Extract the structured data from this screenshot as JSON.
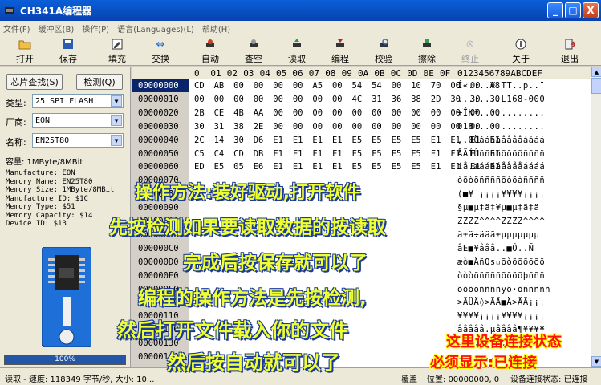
{
  "window": {
    "title": "CH341A编程器"
  },
  "window_controls": {
    "minimize": "_",
    "maximize": "□",
    "close": "X"
  },
  "menu": [
    "文件(F)",
    "缓冲区(B)",
    "操作(P)",
    "语言(Languages)(L)",
    "帮助(H)"
  ],
  "toolbar": [
    {
      "label": "打开",
      "icon": "open-icon",
      "glyph": "📂",
      "disabled": false
    },
    {
      "label": "保存",
      "icon": "save-icon",
      "glyph": "💾",
      "disabled": false
    },
    {
      "label": "填充",
      "icon": "fill-icon",
      "glyph": "✎",
      "disabled": false
    },
    {
      "label": "交换",
      "icon": "swap-icon",
      "glyph": "⇔",
      "disabled": false
    },
    {
      "label": "自动",
      "icon": "auto-icon",
      "glyph": "◆",
      "disabled": false
    },
    {
      "label": "查空",
      "icon": "blank-check-icon",
      "glyph": "◆",
      "disabled": false
    },
    {
      "label": "读取",
      "icon": "read-icon",
      "glyph": "◆",
      "disabled": false
    },
    {
      "label": "编程",
      "icon": "program-icon",
      "glyph": "◆",
      "disabled": false
    },
    {
      "label": "校验",
      "icon": "verify-icon",
      "glyph": "◆",
      "disabled": false
    },
    {
      "label": "擦除",
      "icon": "erase-icon",
      "glyph": "◆",
      "disabled": false
    },
    {
      "label": "终止",
      "icon": "stop-icon",
      "glyph": "⊗",
      "disabled": true
    },
    {
      "label": "关于",
      "icon": "about-icon",
      "glyph": "ⓘ",
      "disabled": false
    },
    {
      "label": "退出",
      "icon": "exit-icon",
      "glyph": "⇥",
      "disabled": false
    }
  ],
  "left": {
    "find_chip": "芯片查找(S)",
    "detect": "检测(Q)",
    "type_label": "类型:",
    "type_value": "25 SPI FLASH",
    "vendor_label": "厂商:",
    "vendor_value": "EON",
    "name_label": "名称:",
    "name_value": "EN25T80",
    "capacity": "容量: 1MByte/8MBit",
    "info": [
      "Manufacture: EON",
      "Memory Name: EN25T80",
      "Memory Size: 1MByte/8MBit",
      "Manufacture ID: $1C",
      "Memory Type: $51",
      "Memory Capacity: $14",
      "Device ID: $13"
    ],
    "progress_text": "100%",
    "progress_value": 1.0
  },
  "hex": {
    "header_cols": [
      "0",
      "01",
      "02",
      "03",
      "04",
      "05",
      "06",
      "07",
      "08",
      "09",
      "0A",
      "0B",
      "0C",
      "0D",
      "0E",
      "0F"
    ],
    "ascii_header": "0123456789ABCDEF",
    "rows": [
      {
        "addr": "00000000",
        "bytes": "CD AB 00 00 00 00 A5 00 54 54 00 10 70 00 00 A8",
        "ascii": "Í«....¥.TT..p..¨"
      },
      {
        "addr": "00000010",
        "bytes": "00 00 00 00 00 00 00 00 4C 31 36 38 2D 30 30 30",
        "ascii": "........L168-000"
      },
      {
        "addr": "00000020",
        "bytes": "2B CE 4B AA 00 00 00 00 00 00 00 00 00 00 00 00",
        "ascii": "+ÎKª............"
      },
      {
        "addr": "00000030",
        "bytes": "30 31 38 2E 00 00 00 00 00 00 00 00 00 00 00 00",
        "ascii": "018............."
      },
      {
        "addr": "00000040",
        "bytes": "2C 14 30 D6 E1 E1 E1 E1 E5 E5 E5 E5 E1 E1 E1 E1",
        "ascii": ",.0Öááááååååáááá"
      },
      {
        "addr": "00000050",
        "bytes": "C5 C4 CD DB F1 F1 F1 F1 F5 F5 F5 F5 F1 F1 F1 F1",
        "ascii": "ÅÄÍÛññññõõõõññññ"
      },
      {
        "addr": "00000060",
        "bytes": "ED E5 05 E6 E1 E1 E1 E1 E5 E5 E5 E5 E1 E1 E1 E1",
        "ascii": "íå.æááááååååáááá"
      },
      {
        "addr": "00000070",
        "bytes": "",
        "ascii": "òõòõññññõòõàññññ"
      },
      {
        "addr": "00000080",
        "bytes": "",
        "ascii": "(■¥ ¡¡¡¡¥¥¥¥¡¡¡¡"
      },
      {
        "addr": "00000090",
        "bytes": "",
        "ascii": "§µ■µ‡ä‡¥µ■µ‡ä‡ä"
      },
      {
        "addr": "000000A0",
        "bytes": "",
        "ascii": "ZZZZ^^^^ZZZZ^^^^"
      },
      {
        "addr": "000000B0",
        "bytes": "",
        "ascii": "ä±ä÷ääã±µµµµµµµ"
      },
      {
        "addr": "000000C0",
        "bytes": "",
        "ascii": "åE■¥ååå..■Ô..Ñ"
      },
      {
        "addr": "000000D0",
        "bytes": "",
        "ascii": "æò■ÅñQs▫õòõõõõõõ"
      },
      {
        "addr": "000000E0",
        "bytes": "",
        "ascii": "òòòõññññõõõõþñññ"
      },
      {
        "addr": "000000F0",
        "bytes": "",
        "ascii": "õõõõññññÿõ·õñññññ"
      },
      {
        "addr": "00000100",
        "bytes": "",
        "ascii": ">ÄÜÄ◊>ÄÄ■Ä>ÄÄ¡¡¡"
      },
      {
        "addr": "00000110",
        "bytes": "",
        "ascii": "¥¥¥¥¡¡¡¡¥¥¥¥¡¡¡¡"
      },
      {
        "addr": "00000120",
        "bytes": "",
        "ascii": "ååååå.µåååå¶¥¥¥¥"
      },
      {
        "addr": "00000130",
        "bytes": "",
        "ascii": "............."
      },
      {
        "addr": "00000140",
        "bytes": "",
        "ascii": "............."
      }
    ]
  },
  "status": {
    "speed": "读取 - 速度: 118349 字节/秒, 大小: 10...",
    "overwrite": "覆盖",
    "position": "位置: 00000000, 0",
    "conn": "设备连接状态: 已连接"
  },
  "overlays": [
    {
      "text": "操作方法:装好驱动,打开软件",
      "color": "yellow"
    },
    {
      "text": "先按检测如果要读取数据的按读取",
      "color": "yellow"
    },
    {
      "text": "完成后按保存就可以了",
      "color": "yellow"
    },
    {
      "text": "编程的操作方法是先按检测,",
      "color": "yellow"
    },
    {
      "text": "然后打开文件载入你的文件",
      "color": "yellow"
    },
    {
      "text": "然后按自动就可以了",
      "color": "yellow"
    },
    {
      "text": "这里设备连接状态",
      "color": "red"
    },
    {
      "text": "必须显示:已连接",
      "color": "red"
    }
  ]
}
